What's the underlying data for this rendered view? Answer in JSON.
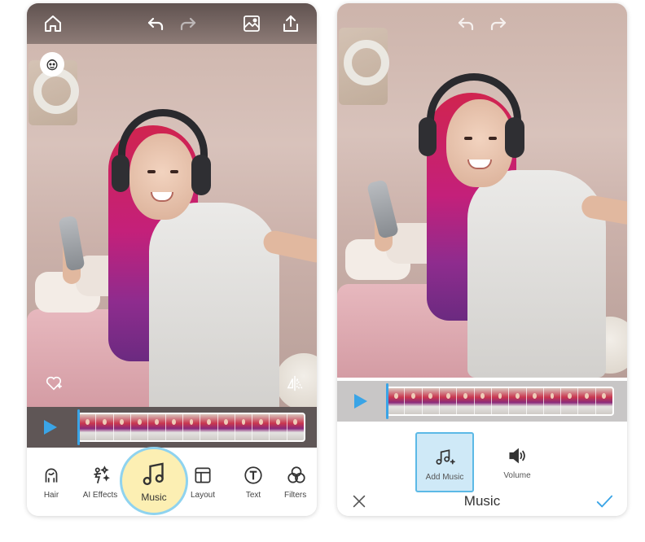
{
  "left_phone": {
    "toolbar": [
      {
        "id": "hair",
        "label": "Hair",
        "icon": "hair-icon"
      },
      {
        "id": "ai-effects",
        "label": "AI Effects",
        "icon": "sparkle-figure-icon"
      },
      {
        "id": "music",
        "label": "Music",
        "icon": "music-note-icon",
        "active": true
      },
      {
        "id": "layout",
        "label": "Layout",
        "icon": "layout-icon"
      },
      {
        "id": "text",
        "label": "Text",
        "icon": "text-icon"
      },
      {
        "id": "filters",
        "label": "Filters",
        "icon": "filters-icon"
      }
    ]
  },
  "right_phone": {
    "panel": {
      "title": "Music",
      "options": [
        {
          "id": "add-music",
          "label": "Add Music",
          "icon": "add-music-icon",
          "selected": true
        },
        {
          "id": "volume",
          "label": "Volume",
          "icon": "speaker-icon"
        }
      ]
    }
  },
  "colors": {
    "accent_blue": "#3aa4e6",
    "music_highlight": "#fcefb3",
    "selected_option_bg": "#cfe9f7"
  }
}
